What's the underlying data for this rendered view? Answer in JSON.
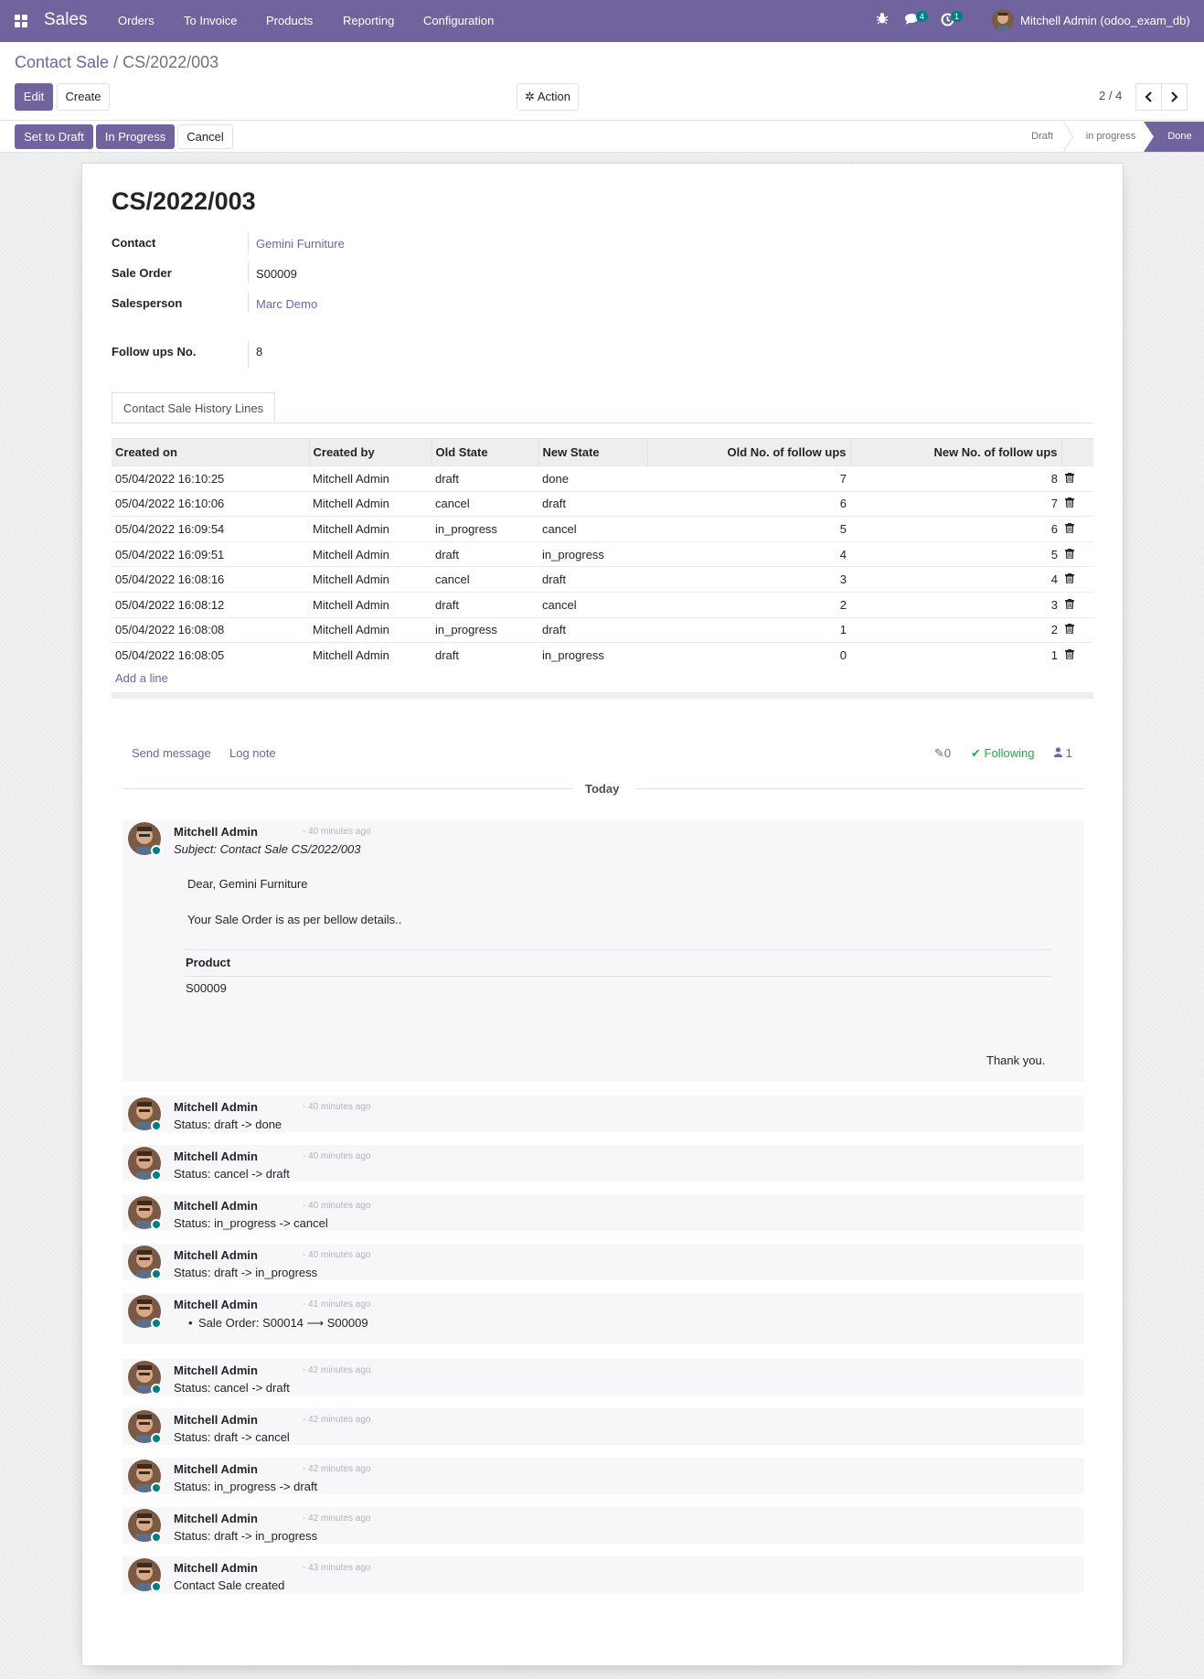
{
  "topbar": {
    "brand": "Sales",
    "menu": [
      "Orders",
      "To Invoice",
      "Products",
      "Reporting",
      "Configuration"
    ],
    "messages_badge": "4",
    "activities_badge": "1",
    "user": "Mitchell Admin (odoo_exam_db)"
  },
  "breadcrumb": {
    "parent": "Contact Sale",
    "separator": "/",
    "current": "CS/2022/003"
  },
  "control": {
    "edit": "Edit",
    "create": "Create",
    "action": "Action",
    "pager": "2 / 4"
  },
  "statusbar": {
    "buttons": [
      "Set to Draft",
      "In Progress",
      "Cancel"
    ],
    "stages": [
      "Draft",
      "in progress",
      "Done"
    ]
  },
  "record": {
    "title": "CS/2022/003",
    "fields": {
      "contact_label": "Contact",
      "contact_value": "Gemini Furniture",
      "sale_order_label": "Sale Order",
      "sale_order_value": "S00009",
      "salesperson_label": "Salesperson",
      "salesperson_value": "Marc Demo",
      "followups_label": "Follow ups No.",
      "followups_value": "8"
    },
    "tab": "Contact Sale History Lines"
  },
  "history": {
    "headers": [
      "Created on",
      "Created by",
      "Old State",
      "New State",
      "Old No. of follow ups",
      "New No. of follow ups"
    ],
    "rows": [
      [
        "05/04/2022 16:10:25",
        "Mitchell Admin",
        "draft",
        "done",
        "7",
        "8"
      ],
      [
        "05/04/2022 16:10:06",
        "Mitchell Admin",
        "cancel",
        "draft",
        "6",
        "7"
      ],
      [
        "05/04/2022 16:09:54",
        "Mitchell Admin",
        "in_progress",
        "cancel",
        "5",
        "6"
      ],
      [
        "05/04/2022 16:09:51",
        "Mitchell Admin",
        "draft",
        "in_progress",
        "4",
        "5"
      ],
      [
        "05/04/2022 16:08:16",
        "Mitchell Admin",
        "cancel",
        "draft",
        "3",
        "4"
      ],
      [
        "05/04/2022 16:08:12",
        "Mitchell Admin",
        "draft",
        "cancel",
        "2",
        "3"
      ],
      [
        "05/04/2022 16:08:08",
        "Mitchell Admin",
        "in_progress",
        "draft",
        "1",
        "2"
      ],
      [
        "05/04/2022 16:08:05",
        "Mitchell Admin",
        "draft",
        "in_progress",
        "0",
        "1"
      ]
    ],
    "add_line": "Add a line"
  },
  "chatter": {
    "send_message": "Send message",
    "log_note": "Log note",
    "attachments": "0",
    "following": "Following",
    "followers": "1",
    "today": "Today",
    "email": {
      "author": "Mitchell Admin",
      "ago": "- 40 minutes ago",
      "subject": "Subject: Contact Sale CS/2022/003",
      "greeting": "Dear, Gemini Furniture",
      "intro": "Your Sale Order is as per bellow details..",
      "product_header": "Product",
      "product_value": "S00009",
      "thanks": "Thank you."
    },
    "messages": [
      {
        "author": "Mitchell Admin",
        "ago": "- 40 minutes ago",
        "body": "Status: draft -> done"
      },
      {
        "author": "Mitchell Admin",
        "ago": "- 40 minutes ago",
        "body": "Status: cancel -> draft"
      },
      {
        "author": "Mitchell Admin",
        "ago": "- 40 minutes ago",
        "body": "Status: in_progress -> cancel"
      },
      {
        "author": "Mitchell Admin",
        "ago": "- 40 minutes ago",
        "body": "Status: draft -> in_progress"
      },
      {
        "author": "Mitchell Admin",
        "ago": "- 41 minutes ago",
        "body": "Sale Order: S00014 ⟶ S00009"
      },
      {
        "author": "Mitchell Admin",
        "ago": "- 42 minutes ago",
        "body": "Status: cancel -> draft"
      },
      {
        "author": "Mitchell Admin",
        "ago": "- 42 minutes ago",
        "body": "Status: draft -> cancel"
      },
      {
        "author": "Mitchell Admin",
        "ago": "- 42 minutes ago",
        "body": "Status: in_progress -> draft"
      },
      {
        "author": "Mitchell Admin",
        "ago": "- 42 minutes ago",
        "body": "Status: draft -> in_progress"
      },
      {
        "author": "Mitchell Admin",
        "ago": "- 43 minutes ago",
        "body": "Contact Sale created"
      }
    ]
  },
  "colors": {
    "brand": "#71639e",
    "teal": "#017e84",
    "following": "#28a745"
  }
}
